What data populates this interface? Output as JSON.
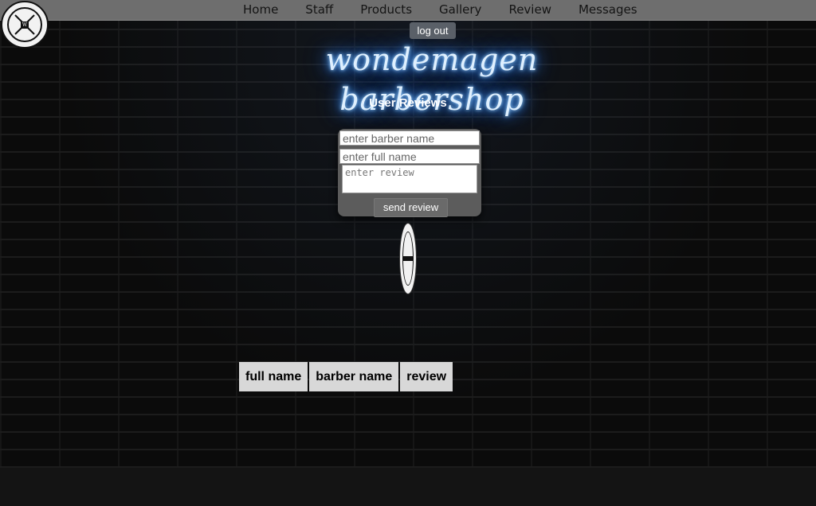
{
  "nav": {
    "items": [
      "Home",
      "Staff",
      "Products",
      "Gallery",
      "Review",
      "Messages"
    ]
  },
  "logo": {
    "alt_text": "GENTLEMEN'S WONDEMAGEN BARBERSHOP"
  },
  "header": {
    "logout_label": "log out",
    "brand_sign": "wondemagen barbershop"
  },
  "page": {
    "title": "User Reviews"
  },
  "review_form": {
    "barber_placeholder": "enter barber name",
    "fullname_placeholder": "enter full name",
    "review_placeholder": "enter review",
    "send_label": "send review"
  },
  "reviews_table": {
    "columns": [
      "full name",
      "barber name",
      "review"
    ],
    "rows": []
  },
  "colors": {
    "neon_glow": "#4fa3ff",
    "navbar": "#6e6e6e",
    "form_card": "#5c5c5c",
    "table_header": "#d8d8d8"
  },
  "icons": {
    "logo": "barbershop-logo-icon",
    "emblem": "barbershop-emblem-icon"
  }
}
